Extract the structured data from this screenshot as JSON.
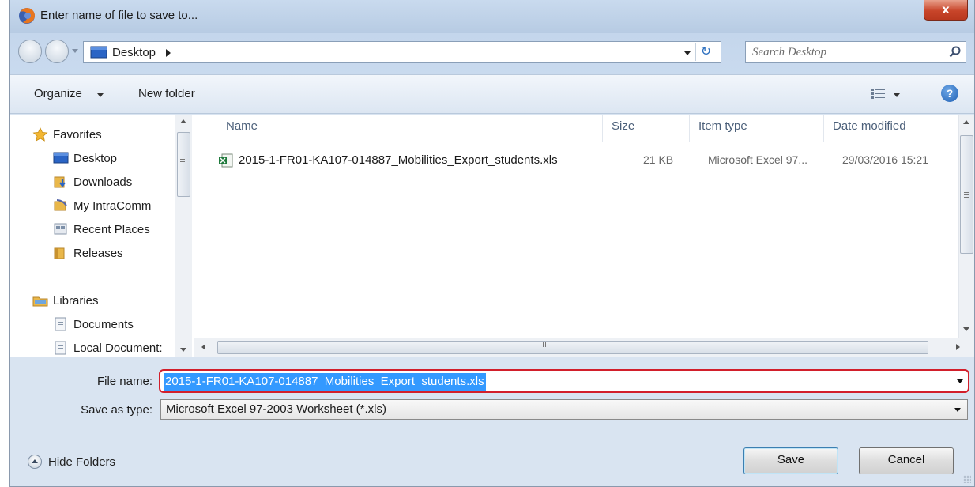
{
  "window": {
    "title": "Enter name of file to save to...",
    "close_label": "x"
  },
  "address": {
    "crumb": "Desktop",
    "refresh_glyph": "↻"
  },
  "search": {
    "placeholder": "Search Desktop"
  },
  "toolbar": {
    "organize_label": "Organize",
    "new_folder_label": "New folder",
    "help_label": "?"
  },
  "navpane": {
    "favorites_label": "Favorites",
    "favorites": [
      "Desktop",
      "Downloads",
      "My IntraComm",
      "Recent Places",
      "Releases"
    ],
    "libraries_label": "Libraries",
    "libraries": [
      "Documents",
      "Local Document:"
    ]
  },
  "filelist": {
    "columns": [
      "Name",
      "Size",
      "Item type",
      "Date modified"
    ],
    "files": [
      {
        "name": "2015-1-FR01-KA107-014887_Mobilities_Export_students.xls",
        "size": "21 KB",
        "type": "Microsoft Excel 97...",
        "date": "29/03/2016 15:21"
      }
    ]
  },
  "form": {
    "file_name_label": "File name:",
    "file_name_value": "2015-1-FR01-KA107-014887_Mobilities_Export_students.xls",
    "save_type_label": "Save as type:",
    "save_type_value": "Microsoft Excel 97-2003 Worksheet (*.xls)"
  },
  "footer": {
    "hide_folders_label": "Hide Folders",
    "save_label": "Save",
    "cancel_label": "Cancel"
  },
  "colors": {
    "highlight_border": "#d21f2b",
    "selection": "#3399ff"
  }
}
